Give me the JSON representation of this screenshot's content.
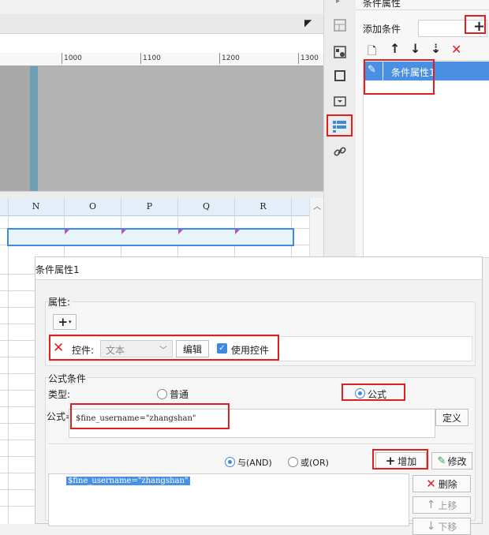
{
  "ruler": {
    "ticks": [
      "1000",
      "1100",
      "1200",
      "1300"
    ]
  },
  "grid": {
    "columns": [
      "N",
      "O",
      "P",
      "Q",
      "R"
    ]
  },
  "right_panel": {
    "title": "条件属性",
    "add_condition_label": "添加条件",
    "list_items": [
      "条件属性1"
    ]
  },
  "dialog": {
    "title": "条件属性1",
    "attributes_label": "属性:",
    "control_label": "控件:",
    "control_value": "文本",
    "edit_button": "编辑",
    "use_control_label": "使用控件",
    "formula_section": "公式条件",
    "type_label": "类型:",
    "type_normal": "普通",
    "type_formula": "公式",
    "formula_label": "公式=",
    "formula_value": "$fine_username=\"zhangshan\"",
    "define_button": "定义",
    "and_label": "与(AND)",
    "or_label": "或(OR)",
    "add_button": "增加",
    "modify_button": "修改",
    "delete_button": "删除",
    "move_up_button": "上移",
    "move_down_button": "下移",
    "condition_list": [
      "$fine_username=\"zhangshan\""
    ]
  },
  "colors": {
    "accent": "#3d8be0",
    "highlight_red": "#e02020",
    "selection_bg": "#4a90e2"
  }
}
